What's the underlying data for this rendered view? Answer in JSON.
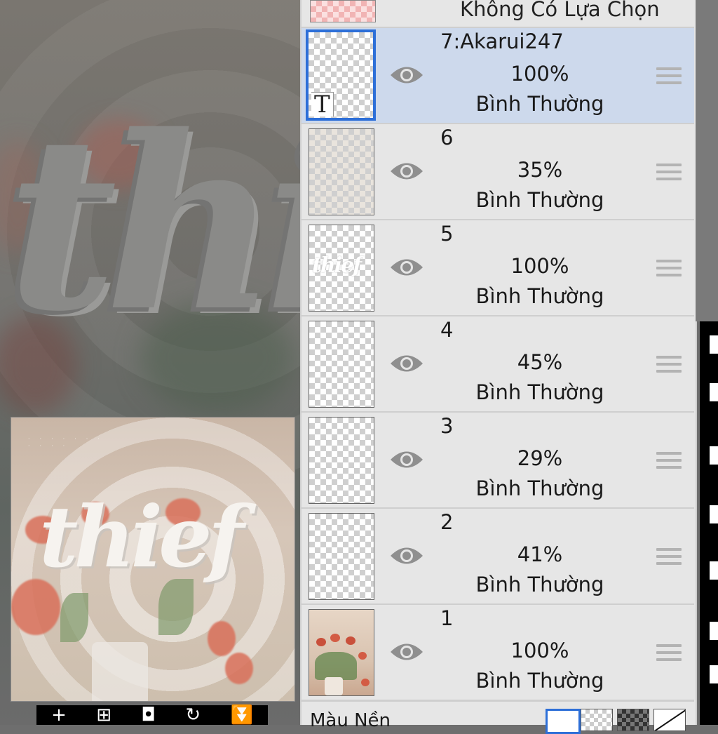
{
  "canvas": {
    "big_word": "thi",
    "preview_word": "thief"
  },
  "layers_panel": {
    "no_selection_label": "Không Có Lựa Chọn",
    "layers": [
      {
        "name": "7:Akarui247",
        "opacity": "100%",
        "blend": "Bình Thường",
        "selected": true,
        "type": "text"
      },
      {
        "name": "6",
        "opacity": "35%",
        "blend": "Bình Thường",
        "selected": false
      },
      {
        "name": "5",
        "opacity": "100%",
        "blend": "Bình Thường",
        "selected": false
      },
      {
        "name": "4",
        "opacity": "45%",
        "blend": "Bình Thường",
        "selected": false
      },
      {
        "name": "3",
        "opacity": "29%",
        "blend": "Bình Thường",
        "selected": false
      },
      {
        "name": "2",
        "opacity": "41%",
        "blend": "Bình Thường",
        "selected": false
      },
      {
        "name": "1",
        "opacity": "100%",
        "blend": "Bình Thường",
        "selected": false
      }
    ],
    "text_layer_mark": "T",
    "background_label": "Màu Nền"
  },
  "colors": {
    "selected_row": "#cdd9ec",
    "selected_border": "#2d6fd8",
    "panel_bg": "#e6e6e6"
  }
}
